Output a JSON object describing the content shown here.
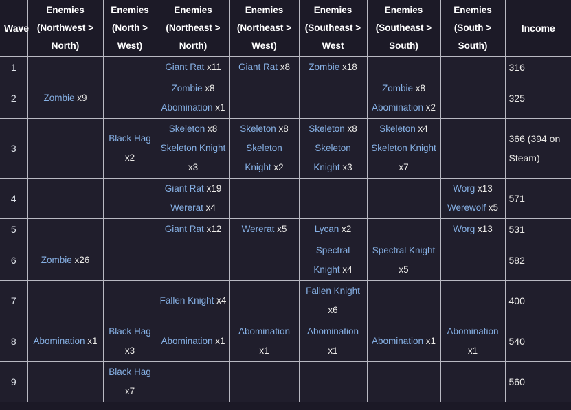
{
  "table": {
    "name": "enemy-wave-table",
    "columns": [
      {
        "key": "wave",
        "label": "Wave"
      },
      {
        "key": "nw_n",
        "label": "Enemies (Northwest > North)"
      },
      {
        "key": "n_w",
        "label": "Enemies (North > West)"
      },
      {
        "key": "ne_n",
        "label": "Enemies (Northeast > North)"
      },
      {
        "key": "ne_w",
        "label": "Enemies (Northeast > West)"
      },
      {
        "key": "se_w",
        "label": "Enemies (Southeast > West"
      },
      {
        "key": "se_s",
        "label": "Enemies (Southeast > South)"
      },
      {
        "key": "s_s",
        "label": "Enemies (South > South)"
      },
      {
        "key": "income",
        "label": "Income"
      }
    ],
    "rows": [
      {
        "wave": "1",
        "nw_n": [],
        "n_w": [],
        "ne_n": [
          {
            "name": "Giant Rat",
            "count": "x11"
          }
        ],
        "ne_w": [
          {
            "name": "Giant Rat",
            "count": "x8"
          }
        ],
        "se_w": [
          {
            "name": "Zombie",
            "count": "x18"
          }
        ],
        "se_s": [],
        "s_s": [],
        "income": "316"
      },
      {
        "wave": "2",
        "nw_n": [
          {
            "name": "Zombie",
            "count": "x9"
          }
        ],
        "n_w": [],
        "ne_n": [
          {
            "name": "Zombie",
            "count": "x8"
          },
          {
            "name": "Abomination",
            "count": "x1"
          }
        ],
        "ne_w": [],
        "se_w": [],
        "se_s": [
          {
            "name": "Zombie",
            "count": "x8"
          },
          {
            "name": "Abomination",
            "count": "x2"
          }
        ],
        "s_s": [],
        "income": "325"
      },
      {
        "wave": "3",
        "nw_n": [],
        "n_w": [
          {
            "name": "Black Hag",
            "count": "x2"
          }
        ],
        "ne_n": [
          {
            "name": "Skeleton",
            "count": "x8"
          },
          {
            "name": "Skeleton Knight",
            "count": "x3"
          }
        ],
        "ne_w": [
          {
            "name": "Skeleton",
            "count": "x8"
          },
          {
            "name": "Skeleton Knight",
            "count": "x2"
          }
        ],
        "se_w": [
          {
            "name": "Skeleton",
            "count": "x8"
          },
          {
            "name": "Skeleton Knight",
            "count": "x3"
          }
        ],
        "se_s": [
          {
            "name": "Skeleton",
            "count": "x4"
          },
          {
            "name": "Skeleton Knight",
            "count": "x7"
          }
        ],
        "s_s": [],
        "income": "366 (394 on Steam)"
      },
      {
        "wave": "4",
        "nw_n": [],
        "n_w": [],
        "ne_n": [
          {
            "name": "Giant Rat",
            "count": "x19"
          },
          {
            "name": "Wererat",
            "count": "x4"
          }
        ],
        "ne_w": [],
        "se_w": [],
        "se_s": [],
        "s_s": [
          {
            "name": "Worg",
            "count": "x13"
          },
          {
            "name": "Werewolf",
            "count": "x5"
          }
        ],
        "income": "571"
      },
      {
        "wave": "5",
        "nw_n": [],
        "n_w": [],
        "ne_n": [
          {
            "name": "Giant Rat",
            "count": "x12"
          }
        ],
        "ne_w": [
          {
            "name": "Wererat",
            "count": "x5"
          }
        ],
        "se_w": [
          {
            "name": "Lycan",
            "count": "x2"
          }
        ],
        "se_s": [],
        "s_s": [
          {
            "name": "Worg",
            "count": "x13"
          }
        ],
        "income": "531"
      },
      {
        "wave": "6",
        "nw_n": [
          {
            "name": "Zombie",
            "count": "x26"
          }
        ],
        "n_w": [],
        "ne_n": [],
        "ne_w": [],
        "se_w": [
          {
            "name": "Spectral Knight",
            "count": "x4"
          }
        ],
        "se_s": [
          {
            "name": "Spectral Knight",
            "count": "x5"
          }
        ],
        "s_s": [],
        "income": "582"
      },
      {
        "wave": "7",
        "nw_n": [],
        "n_w": [],
        "ne_n": [
          {
            "name": "Fallen Knight",
            "count": "x4"
          }
        ],
        "ne_w": [],
        "se_w": [
          {
            "name": "Fallen Knight",
            "count": "x6"
          }
        ],
        "se_s": [],
        "s_s": [],
        "income": "400"
      },
      {
        "wave": "8",
        "nw_n": [
          {
            "name": "Abomination",
            "count": "x1"
          }
        ],
        "n_w": [
          {
            "name": "Black Hag",
            "count": "x3"
          }
        ],
        "ne_n": [
          {
            "name": "Abomination",
            "count": "x1"
          }
        ],
        "ne_w": [
          {
            "name": "Abomination",
            "count": "x1"
          }
        ],
        "se_w": [
          {
            "name": "Abomination",
            "count": "x1"
          }
        ],
        "se_s": [
          {
            "name": "Abomination",
            "count": "x1"
          }
        ],
        "s_s": [
          {
            "name": "Abomination",
            "count": "x1"
          }
        ],
        "income": "540"
      },
      {
        "wave": "9",
        "nw_n": [],
        "n_w": [
          {
            "name": "Black Hag",
            "count": "x7"
          }
        ],
        "ne_n": [],
        "ne_w": [],
        "se_w": [],
        "se_s": [],
        "s_s": [],
        "income": "560"
      }
    ]
  },
  "colors": {
    "page_background": "#1b1926",
    "cell_background": "#201e2c",
    "header_background": "#1c1a27",
    "border": "#b9b9c2",
    "link": "#86b0e4",
    "text": "#ecebe8",
    "header_text": "#ffffff"
  }
}
